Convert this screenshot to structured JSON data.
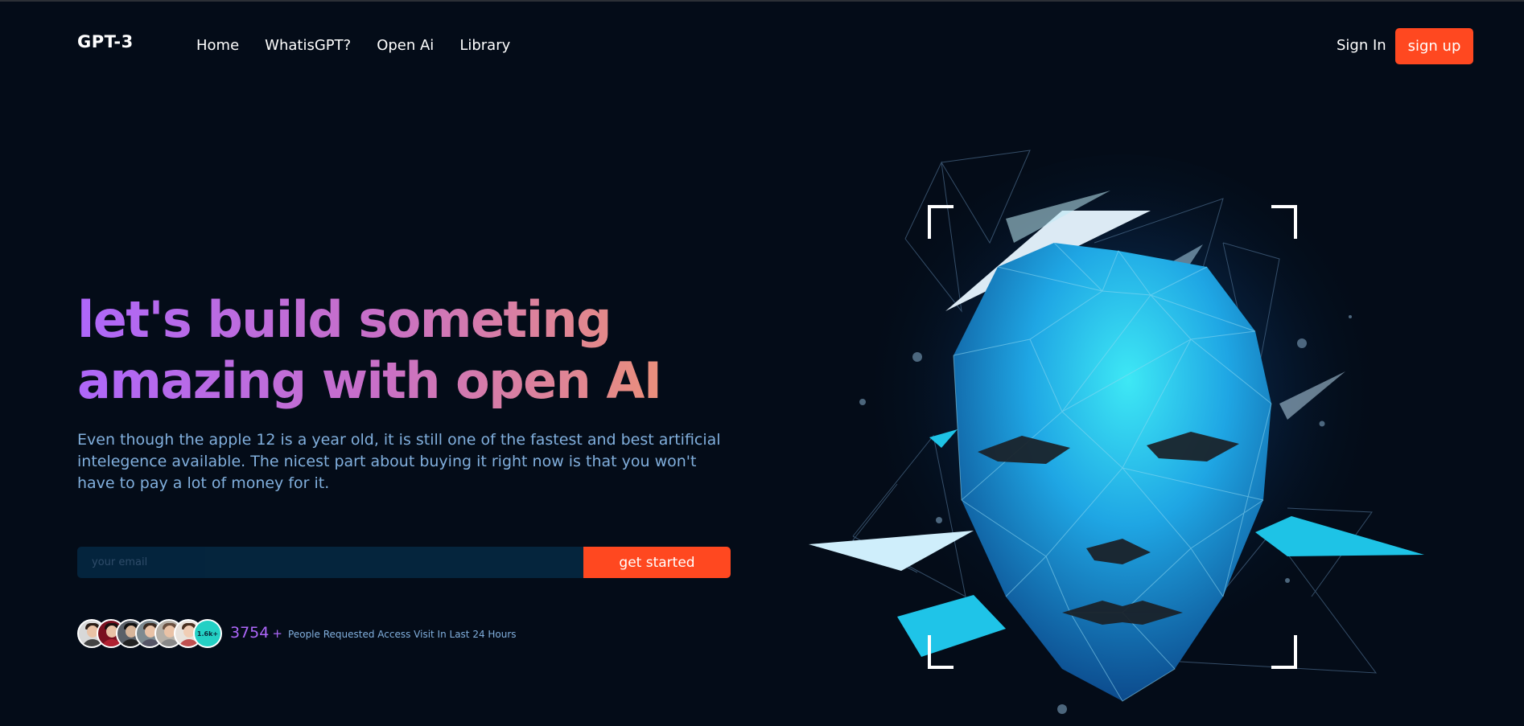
{
  "nav": {
    "logo": "GPT-3",
    "links": [
      "Home",
      "WhatisGPT?",
      "Open Ai",
      "Library"
    ],
    "sign_in": "Sign In",
    "sign_up": "sign up"
  },
  "hero": {
    "headline": "let's build someting amazing with open AI",
    "subtext": "Even though the apple 12 is a year old, it is still one of the fastest and best artificial intelegence available. The nicest part about buying it right now is that you won't have to pay a lot of money for it.",
    "email_placeholder": "your email",
    "cta": "get started",
    "avatar_count_badge": "1.6k+",
    "requests_count": "3754",
    "requests_plus": "+",
    "requests_text": "People Requested Access Visit In Last 24 Hours"
  },
  "colors": {
    "background": "#040c18",
    "accent": "#ff4820",
    "gradient_start": "#ae67fa",
    "gradient_end": "#f49867",
    "subtext": "#81afdd"
  },
  "icons": {
    "hero_illustration": "polygonal-ai-face-icon"
  }
}
